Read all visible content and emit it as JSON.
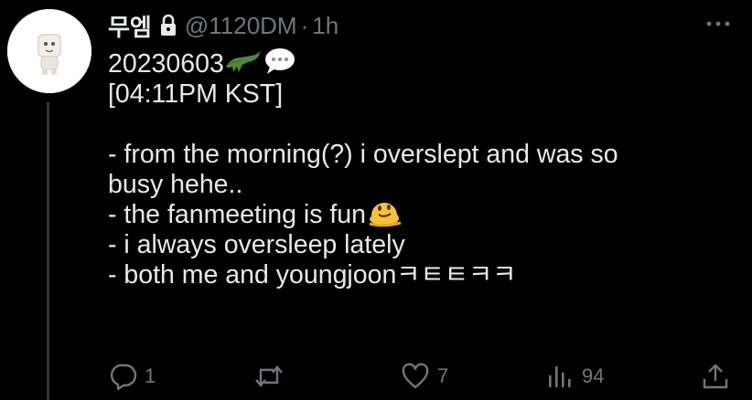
{
  "tweet": {
    "display_name": "무엠",
    "handle": "@1120DM",
    "separator": "·",
    "time": "1h",
    "lines": [
      "20230603",
      "[04:11PM KST]",
      "",
      "- from the morning(?) i overslept and was so",
      "busy hehe..",
      "- the fanmeeting is fun",
      "- i always oversleep lately",
      "- both me and youngjoonㅋㅌㅌㅋㅋ"
    ],
    "emojis": {
      "line0": [
        "crocodile-icon",
        "speech-bubble-icon"
      ],
      "line5": [
        "melting-face-icon"
      ]
    }
  },
  "actions": {
    "reply_count": "1",
    "retweet_count": "",
    "like_count": "7",
    "views_count": "94"
  },
  "colors": {
    "background": "#000000",
    "text": "#e7e9ea",
    "muted": "#71767b",
    "thread_line": "#333639"
  }
}
